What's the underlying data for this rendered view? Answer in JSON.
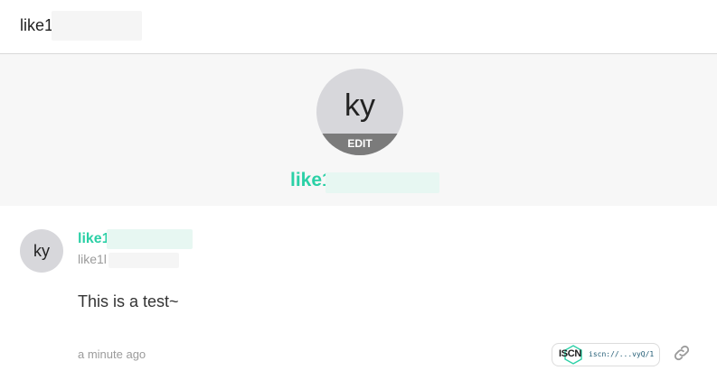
{
  "header": {
    "title": "like1"
  },
  "profile": {
    "avatar_initials": "ky",
    "edit_label": "EDIT",
    "display_name": "like1"
  },
  "post": {
    "avatar_initials": "ky",
    "display_name": "like1",
    "handle": "like1l",
    "content": "This is a test~",
    "timestamp": "a minute ago",
    "iscn_logo": "ISCN",
    "iscn_id": "iscn://...vyQ/1",
    "link_icon": "link-icon"
  },
  "colors": {
    "accent": "#2bd0a6",
    "muted_text": "#9b9b9b",
    "profile_bg": "#f7f7f7",
    "avatar_bg": "#d7d7db",
    "edit_bar": "#7b7b7b"
  }
}
